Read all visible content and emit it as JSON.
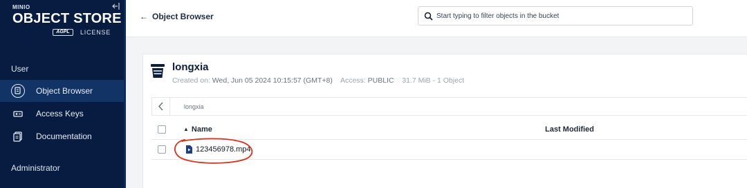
{
  "brand": {
    "product": "MINIO",
    "title": "OBJECT STORE",
    "license_badge": "AGPL",
    "license": "LICENSE"
  },
  "sidebar": {
    "user_section": "User",
    "admin_section": "Administrator",
    "items": [
      {
        "label": "Object Browser",
        "icon": "object-browser-icon",
        "active": true
      },
      {
        "label": "Access Keys",
        "icon": "access-keys-icon",
        "active": false
      },
      {
        "label": "Documentation",
        "icon": "documentation-icon",
        "active": false
      }
    ]
  },
  "header": {
    "back_label": "Object Browser",
    "search_placeholder": "Start typing to filter objects in the bucket"
  },
  "bucket": {
    "name": "longxia",
    "created_label": "Created on:",
    "created_value": "Wed, Jun 05 2024 10:15:57 (GMT+8)",
    "access_label": "Access:",
    "access_value": "PUBLIC",
    "summary": "31.7 MiB - 1 Object"
  },
  "breadcrumb": {
    "path": "longxia"
  },
  "table": {
    "columns": {
      "name": "Name",
      "last_modified": "Last Modified"
    },
    "rows": [
      {
        "name": "123456978.mp4",
        "last_modified": ""
      }
    ]
  },
  "colors": {
    "sidebar_bg": "#081c42",
    "sidebar_active": "#113366",
    "accent": "#1c3d8a",
    "annotation": "#d9301c"
  }
}
